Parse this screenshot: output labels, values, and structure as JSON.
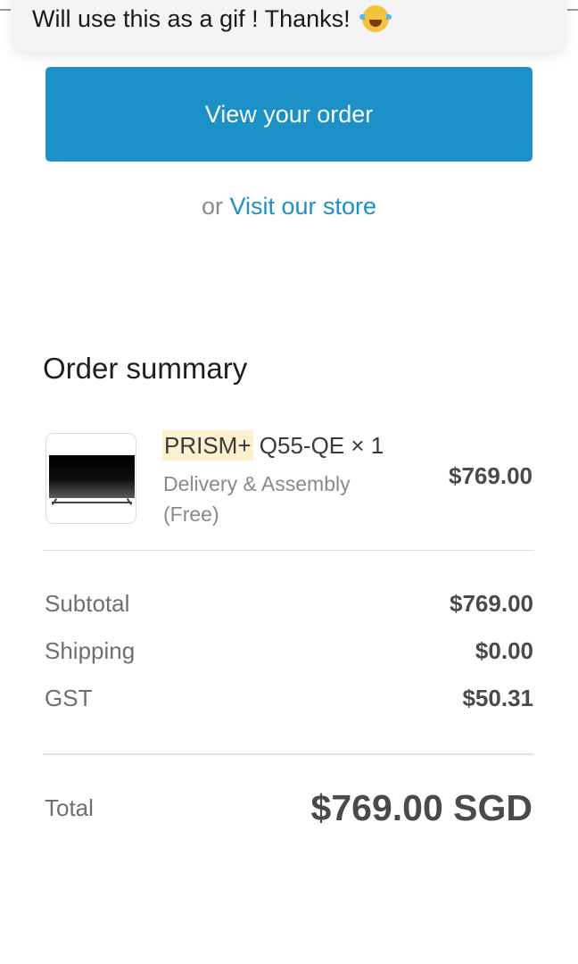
{
  "notification": {
    "message": "Will use this as a gif ! Thanks!",
    "emoji_icon": "tears-of-joy-emoji-icon"
  },
  "actions": {
    "view_order_label": "View your order",
    "or_text": "or",
    "visit_store_label": "Visit our store"
  },
  "colors": {
    "accent": "#1b91c8",
    "brand_highlight": "#fbf1cf"
  },
  "order_summary": {
    "title": "Order summary",
    "item": {
      "brand": "PRISM+",
      "model_qty": "Q55-QE × 1",
      "meta_line1": "Delivery & Assembly",
      "meta_line2": "(Free)",
      "price": "$769.00",
      "thumbnail_icon": "tv-thumbnail"
    },
    "subtotal_label": "Subtotal",
    "subtotal_value": "$769.00",
    "shipping_label": "Shipping",
    "shipping_value": "$0.00",
    "gst_label": "GST",
    "gst_value": "$50.31",
    "total_label": "Total",
    "total_value": "$769.00 SGD"
  }
}
